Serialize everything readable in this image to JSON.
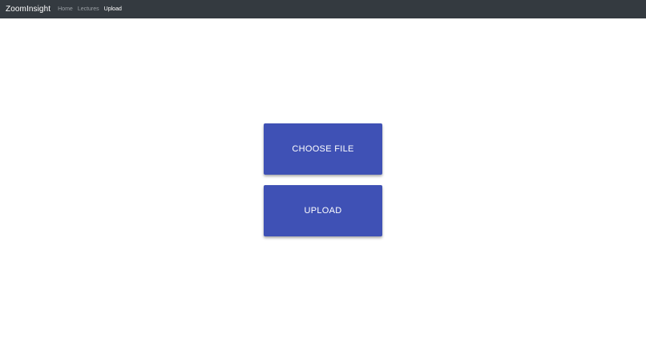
{
  "navbar": {
    "brand": "ZoomInsight",
    "links": [
      {
        "label": "Home",
        "active": false
      },
      {
        "label": "Lectures",
        "active": false
      },
      {
        "label": "Upload",
        "active": true
      }
    ]
  },
  "main": {
    "choose_file_label": "CHOOSE FILE",
    "upload_label": "UPLOAD"
  },
  "colors": {
    "navbar_bg": "#343a40",
    "button_bg": "#3f51b5",
    "nav_inactive": "#9a9fa4",
    "nav_active": "#ffffff"
  }
}
